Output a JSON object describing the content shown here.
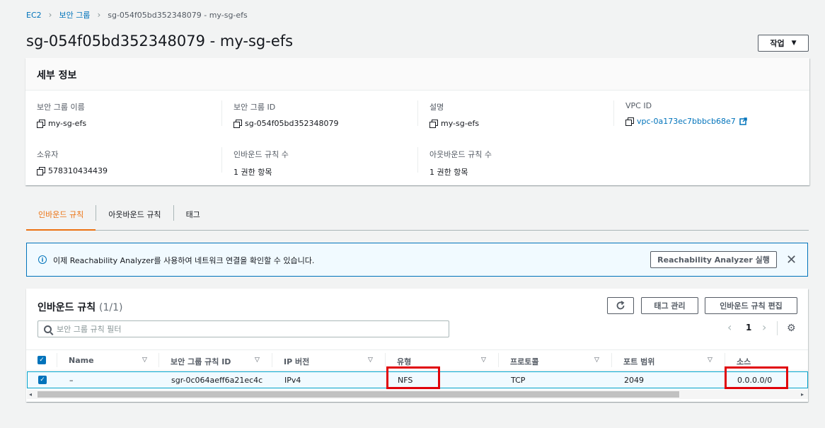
{
  "breadcrumb": {
    "root": "EC2",
    "parent": "보안 그룹",
    "current": "sg-054f05bd352348079 - my-sg-efs"
  },
  "title": "sg-054f05bd352348079 - my-sg-efs",
  "actions_label": "작업",
  "details": {
    "header": "세부 정보",
    "fields": [
      {
        "label": "보안 그룹 이름",
        "value": "my-sg-efs"
      },
      {
        "label": "보안 그룹 ID",
        "value": "sg-054f05bd352348079"
      },
      {
        "label": "설명",
        "value": "my-sg-efs"
      },
      {
        "label": "VPC ID",
        "value": "vpc-0a173ec7bbbcb68e7"
      },
      {
        "label": "소유자",
        "value": "578310434439"
      },
      {
        "label": "인바운드 규칙 수",
        "value": "1 권한 항목"
      },
      {
        "label": "아웃바운드 규칙 수",
        "value": "1 권한 항목"
      }
    ]
  },
  "tabs": [
    "인바운드 규칙",
    "아웃바운드 규칙",
    "태그"
  ],
  "info": {
    "text": "이제 Reachability Analyzer를 사용하여 네트워크 연결을 확인할 수 있습니다.",
    "button": "Reachability Analyzer 실행"
  },
  "rules": {
    "title": "인바운드 규칙",
    "count": "(1/1)",
    "manage_tags": "태그 관리",
    "edit_rules": "인바운드 규칙 편집",
    "search_placeholder": "보안 그룹 규칙 필터",
    "page": "1",
    "columns": [
      "Name",
      "보안 그룹 규칙 ID",
      "IP 버전",
      "유형",
      "프로토콜",
      "포트 범위",
      "소스"
    ],
    "row": [
      "–",
      "sgr-0c064aeff6a21ec4c",
      "IPv4",
      "NFS",
      "TCP",
      "2049",
      "0.0.0.0/0"
    ]
  },
  "colors": {
    "accent": "#ec7211",
    "link": "#0073bb",
    "highlight": "#e0040b"
  }
}
